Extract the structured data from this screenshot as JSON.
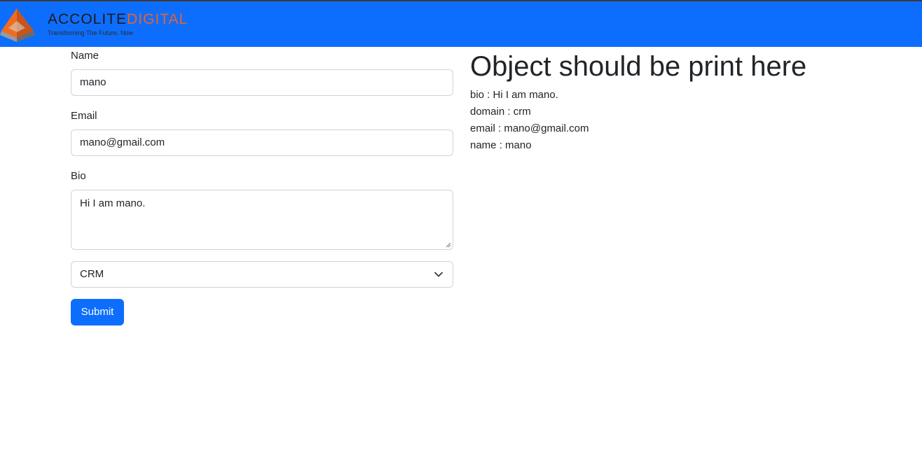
{
  "header": {
    "brand_word1": "ACCOLITE",
    "brand_word2": "DIGITAL",
    "tagline": "Transforming The Future, Now",
    "bg_color": "#0d6efd"
  },
  "form": {
    "name_label": "Name",
    "name_value": "mano",
    "email_label": "Email",
    "email_value": "mano@gmail.com",
    "bio_label": "Bio",
    "bio_value": "Hi I am mano.",
    "domain_selected": "CRM",
    "submit_label": "Submit"
  },
  "output": {
    "title": "Object should be print here",
    "lines": [
      "bio : Hi I am mano.",
      "domain : crm",
      "email : mano@gmail.com",
      "name : mano"
    ]
  },
  "icons": {
    "logo": "pyramid-logo-icon",
    "select_arrow": "chevron-down-icon",
    "textarea_grip": "resize-grip-icon"
  }
}
